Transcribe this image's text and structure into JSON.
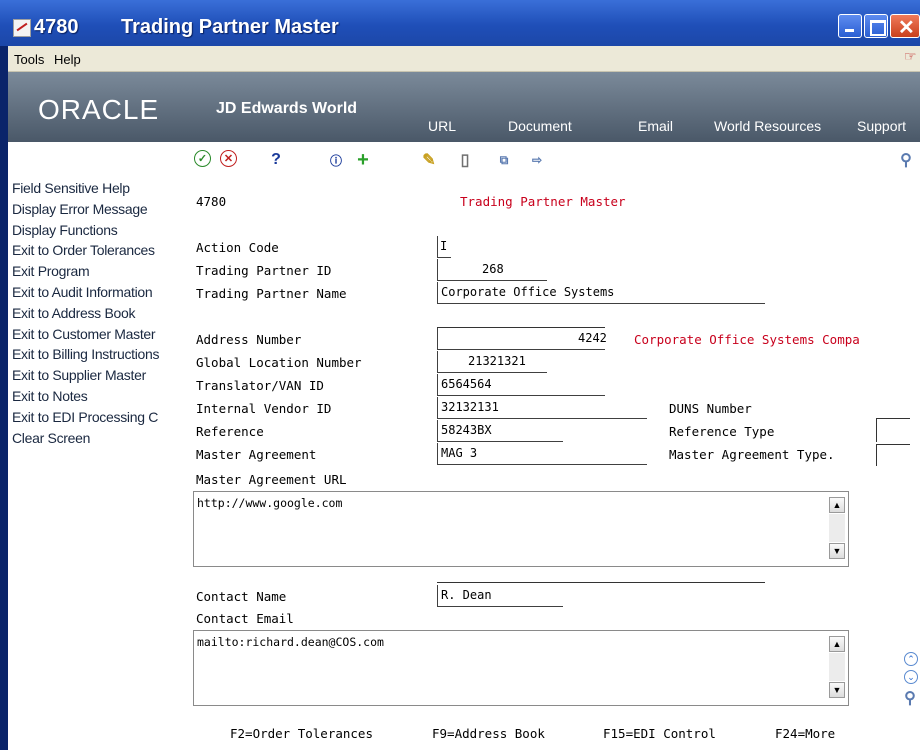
{
  "window": {
    "program_number": "4780",
    "title": "Trading Partner Master"
  },
  "menubar": {
    "tools": "Tools",
    "help": "Help"
  },
  "banner": {
    "logo": "ORACLE",
    "logo_sub": "JD Edwards World",
    "links": [
      "URL",
      "Document",
      "Email",
      "World Resources",
      "Support"
    ]
  },
  "toolbar": {
    "icons": [
      "ok-check-icon",
      "cancel-x-icon",
      "help-question-icon",
      "info-icon",
      "add-plus-icon",
      "change-pencil-icon",
      "delete-trash-icon",
      "copy-icon",
      "export-icon",
      "search-magnifier-icon"
    ]
  },
  "exits": [
    "Field Sensitive Help",
    "Display Error Message",
    "Display Functions",
    "Exit to Order Tolerances",
    "Exit Program",
    "Exit to Audit Information",
    "Exit to Address Book",
    "Exit to Customer Master",
    "Exit to Billing Instructions",
    "Exit to Supplier Master",
    "Exit to Notes",
    "Exit to EDI Processing C",
    "Clear Screen"
  ],
  "form": {
    "program_id": "4780",
    "heading": "Trading Partner Master",
    "action_code": {
      "label": "Action Code",
      "value": "I"
    },
    "trading_partner_id": {
      "label": "Trading Partner ID",
      "value": "268"
    },
    "trading_partner_name": {
      "label": "Trading Partner Name",
      "value": "Corporate Office Systems"
    },
    "address_number": {
      "label": "Address Number",
      "value": "4242",
      "description": "Corporate Office Systems Compa"
    },
    "global_location_number": {
      "label": "Global Location Number",
      "value": "21321321"
    },
    "translator_van_id": {
      "label": "Translator/VAN ID",
      "value": "6564564"
    },
    "internal_vendor_id": {
      "label": "Internal Vendor ID",
      "value": "32132131"
    },
    "duns_number": {
      "label": "DUNS Number",
      "value": ""
    },
    "reference": {
      "label": "Reference",
      "value": "58243BX"
    },
    "reference_type": {
      "label": "Reference Type",
      "value": ""
    },
    "master_agreement": {
      "label": "Master Agreement",
      "value": "MAG 3"
    },
    "master_agreement_type": {
      "label": "Master Agreement Type.",
      "value": ""
    },
    "master_agreement_url": {
      "label": "Master Agreement URL",
      "value": "http://www.google.com"
    },
    "contact_name": {
      "label": "Contact Name",
      "value": "R. Dean"
    },
    "contact_email": {
      "label": "Contact Email",
      "value": "mailto:richard.dean@COS.com"
    }
  },
  "function_keys": [
    "F2=Order Tolerances",
    "F9=Address Book",
    "F15=EDI Control",
    "F24=More"
  ],
  "colors": {
    "title_bar": "#2356c4",
    "banner": "#5a6878",
    "heading_red": "#c8001c",
    "exit_text": "#1a2840"
  }
}
